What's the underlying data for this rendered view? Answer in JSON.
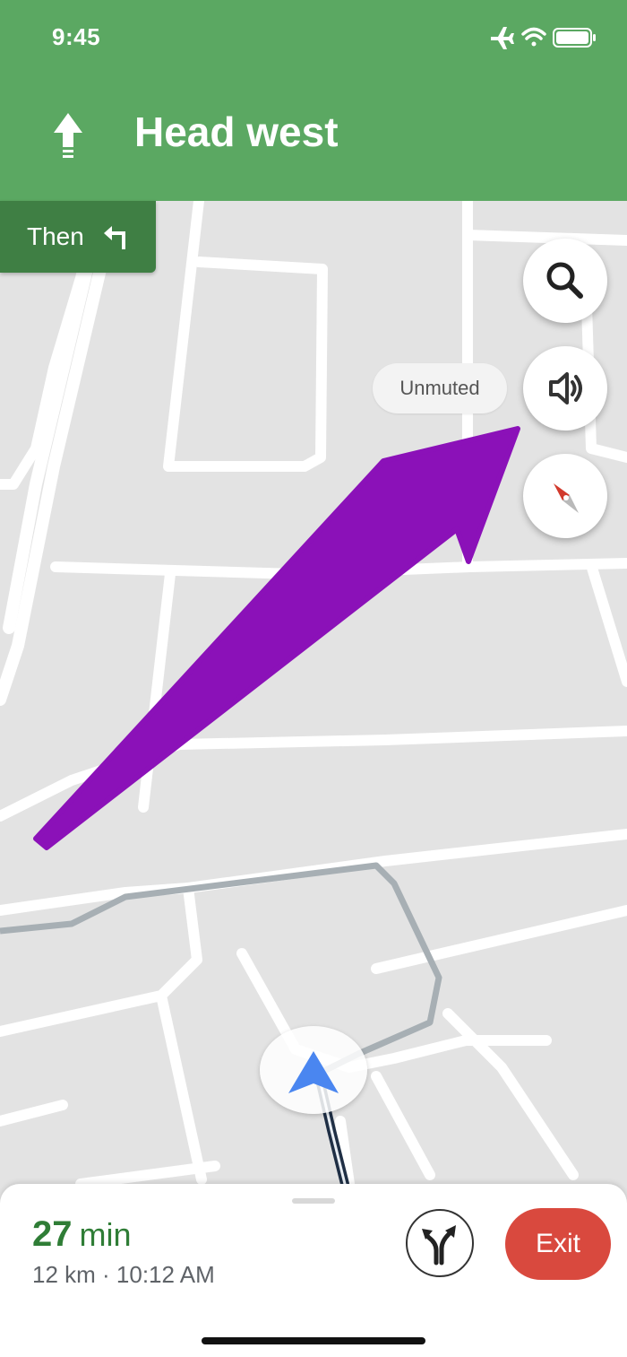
{
  "status_bar": {
    "time": "9:45",
    "icons": [
      "airplane-icon",
      "wifi-icon",
      "battery-icon"
    ]
  },
  "navigation": {
    "direction_icon": "arrow-up-icon",
    "instruction": "Head west",
    "then_label": "Then",
    "then_icon": "turn-left-icon"
  },
  "map_controls": {
    "search_icon": "search-icon",
    "sound_icon": "volume-icon",
    "sound_status": "Unmuted",
    "compass_icon": "compass-icon"
  },
  "annotation": {
    "arrow_color": "#8b11b8"
  },
  "trip_sheet": {
    "eta_value": "27",
    "eta_unit": "min",
    "details": "12 km · 10:12 AM",
    "routes_icon": "alternate-routes-icon",
    "exit_label": "Exit"
  },
  "colors": {
    "header_green": "#5ba862",
    "then_green": "#3f7f44",
    "eta_green": "#2f7d36",
    "exit_red": "#d9493e",
    "location_blue": "#4a86f0"
  }
}
